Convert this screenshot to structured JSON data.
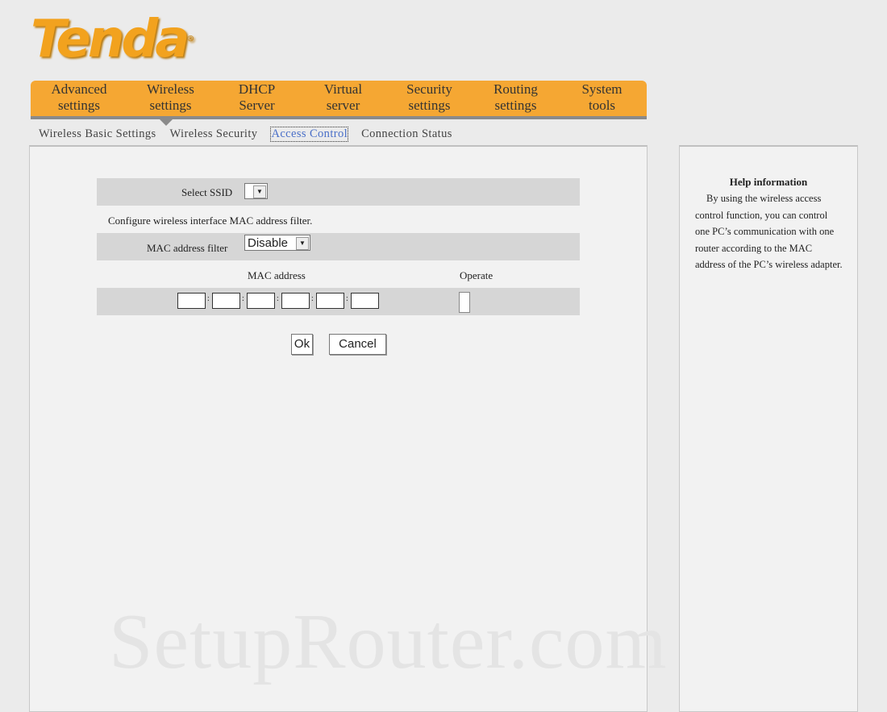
{
  "logo": "Tenda",
  "nav": [
    {
      "line1": "Advanced",
      "line2": "settings"
    },
    {
      "line1": "Wireless",
      "line2": "settings"
    },
    {
      "line1": "DHCP",
      "line2": "Server"
    },
    {
      "line1": "Virtual",
      "line2": "server"
    },
    {
      "line1": "Security",
      "line2": "settings"
    },
    {
      "line1": "Routing",
      "line2": "settings"
    },
    {
      "line1": "System",
      "line2": "tools"
    }
  ],
  "subnav": [
    "Wireless Basic Settings",
    "Wireless Security",
    "Access Control",
    "Connection Status"
  ],
  "form": {
    "select_ssid_label": "Select SSID",
    "select_ssid_value": "",
    "description": "Configure wireless interface MAC address filter.",
    "mac_filter_label": "MAC address filter",
    "mac_filter_value": "Disable",
    "col_mac": "MAC address",
    "col_operate": "Operate",
    "ok": "Ok",
    "cancel": "Cancel"
  },
  "help": {
    "title": "Help information",
    "text": "By using the wireless access control function, you can control one PC’s communication with one router according to the MAC address of the PC’s wireless adapter."
  },
  "watermark": "SetupRouter.com",
  "colors": {
    "nav": "#f5a733",
    "logo": "#f2a21e",
    "active_subtab": "#4a6fc8"
  }
}
